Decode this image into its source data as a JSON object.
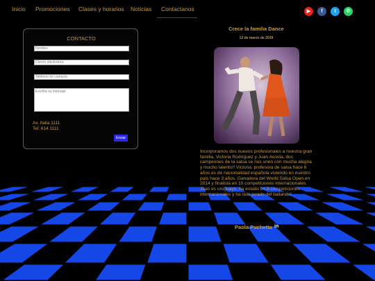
{
  "nav": {
    "items": [
      {
        "label": "Inicio"
      },
      {
        "label": "Promociones"
      },
      {
        "label": "Clases y horarios"
      },
      {
        "label": "Noticias"
      },
      {
        "label": "Contactanos"
      }
    ]
  },
  "social": [
    {
      "icon": "youtube-icon",
      "glyph": "▶",
      "color": "#e62117"
    },
    {
      "icon": "facebook-icon",
      "glyph": "f",
      "color": "#3b5998"
    },
    {
      "icon": "twitter-icon",
      "glyph": "t",
      "color": "#1da1f2"
    },
    {
      "icon": "whatsapp-icon",
      "glyph": "✆",
      "color": "#25d366"
    }
  ],
  "contact": {
    "title": "CONTACTO",
    "name_placeholder": "Nombre",
    "email_placeholder": "Correo electrónico",
    "phone_placeholder": "Teléfono de contacto",
    "message_placeholder": "Escriba su mensaje",
    "address": "Av. Italia 1111",
    "phone": "Tel: 614 1111",
    "send_label": "Enviar"
  },
  "post": {
    "title": "Crece la familia Dance",
    "date": "12 de marzo de 2019",
    "body": "Incorporamos dos nuevos profesionales a nuestra gran familia, Victoria Rodríguez y Juan Acosta, dos campeones de la salsa se nos unen con mucha alegria y mucho talento!! Victoria, profesora de salsa hace 6 años es de nacionalidad española viviendo en nuestro país hace 3 años. Ganadora del World Salsa Open en 2014 y finalista en 10 competiciones internacionales. Juan es uruguayo, ha estado en 8 competiciones internacionales y ha sido jurado del bailando!"
  },
  "footer": {
    "author": "Paola Puchetta",
    "linkedin": "in"
  },
  "colors": {
    "accent": "#c89b45",
    "floor_tile": "#1447e6",
    "button": "#2a28e6"
  }
}
